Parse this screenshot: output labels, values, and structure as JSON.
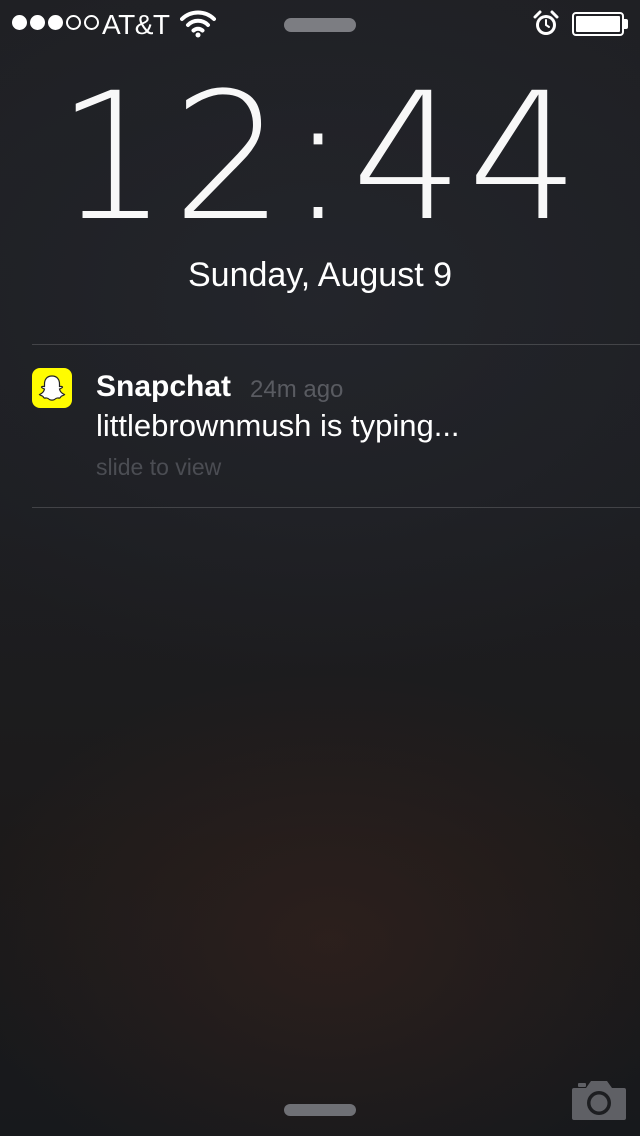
{
  "status_bar": {
    "signal_strength": 3,
    "signal_max": 5,
    "carrier": "AT&T",
    "wifi_icon": "wifi-icon",
    "alarm_icon": "alarm-clock-icon",
    "battery_level": 1.0
  },
  "lock_screen": {
    "time": "12:44",
    "date": "Sunday, August 9"
  },
  "notification": {
    "app_icon": "snapchat-ghost-icon",
    "app_name": "Snapchat",
    "time_ago": "24m ago",
    "message": "littlebrownmush is typing...",
    "action_hint": "slide to view"
  },
  "bottom_bar": {
    "camera_icon": "camera-icon"
  },
  "colors": {
    "snapchat_yellow": "#fffc00",
    "muted_text": "#595b61"
  }
}
